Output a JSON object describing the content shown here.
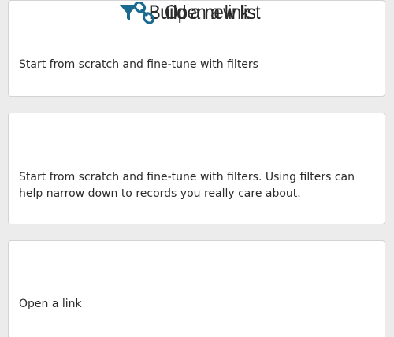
{
  "cards": [
    {
      "icon": "filter-icon",
      "title": "Build a new list",
      "description": "Start from scratch and fine-tune with filters"
    },
    {
      "icon": "filter-icon",
      "title": "Build a new list",
      "description": "Start from scratch and fine-tune with filters. Using filters can help narrow down to records you really care about."
    },
    {
      "icon": "link-icon",
      "title": "Open a link",
      "description": "Open a link"
    }
  ],
  "colors": {
    "accent": "#1a6a8f",
    "background": "#ececec",
    "card": "#ffffff",
    "border": "#d3d3d3",
    "text": "#2b2b2b"
  }
}
